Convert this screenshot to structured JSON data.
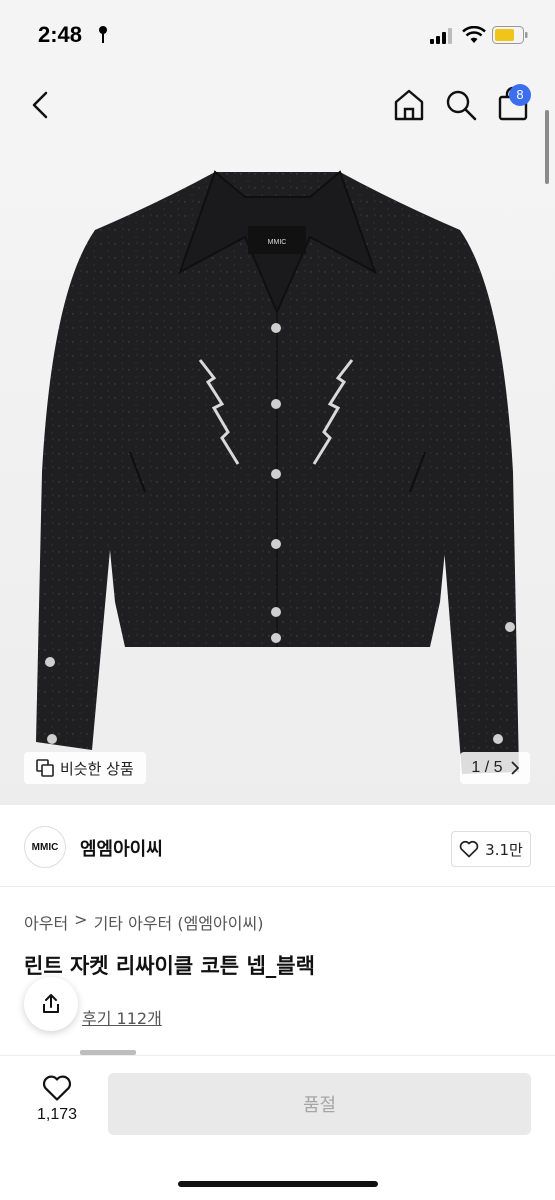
{
  "status_bar": {
    "time": "2:48"
  },
  "nav": {
    "cart_badge": "8"
  },
  "gallery": {
    "similar_label": "비슷한 상품",
    "page_indicator": "1 / 5",
    "brand_tag": "MMIC"
  },
  "brand": {
    "logo_text": "MMIC",
    "name": "엠엠아이씨",
    "likes": "3.1만"
  },
  "product": {
    "breadcrumb": [
      "아우터",
      ">",
      "기타 아우터 (엠엠아이씨)"
    ],
    "title": "린트 자켓 리싸이클 코튼 넵_블랙",
    "review_link": "후기 112개"
  },
  "bottom_bar": {
    "wish_count": "1,173",
    "soldout_label": "품절"
  },
  "colors": {
    "badge": "#3c6ef0",
    "jacket": "#1f1f21",
    "soldout_bg": "#e9e9e9"
  }
}
